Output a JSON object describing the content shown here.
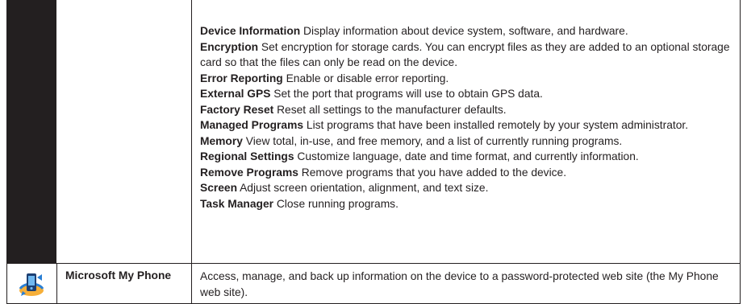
{
  "main": {
    "settings_row": {
      "entries": [
        {
          "term": "Device Information",
          "text": "Display information about device system, software, and hardware."
        },
        {
          "term": "Encryption",
          "text": "Set encryption for storage cards. You can encrypt files as they are added to an optional storage card so that the files can only be read on the device."
        },
        {
          "term": "Error Reporting",
          "text": "Enable or disable error reporting."
        },
        {
          "term": "External GPS",
          "text": "Set the port that programs will use to obtain GPS data."
        },
        {
          "term": "Factory Reset",
          "text": "Reset all settings to the manufacturer defaults."
        },
        {
          "term": "Managed Programs",
          "text": "List programs that have been installed remotely by your system administrator."
        },
        {
          "term": "Memory",
          "text": "View total, in-use, and free memory, and a list of currently running programs."
        },
        {
          "term": "Regional Settings",
          "text": "Customize language, date and time format, and currently information."
        },
        {
          "term": "Remove Programs",
          "text": "Remove programs that you have added to the device."
        },
        {
          "term": "Screen",
          "text": "Adjust screen orientation, alignment, and text size."
        },
        {
          "term": "Task Manager",
          "text": "Close running programs."
        }
      ]
    },
    "my_phone_row": {
      "icon": "microsoft-my-phone-icon",
      "name": "Microsoft My Phone",
      "description": "Access, manage, and back up information on the device to a password-protected web site (the My Phone web site)."
    }
  },
  "colors": {
    "text": "#231f20",
    "border": "#231f20",
    "icon_column_top": "#231f20",
    "icon_blue": "#2a7fd4",
    "icon_orange": "#f5a623"
  }
}
